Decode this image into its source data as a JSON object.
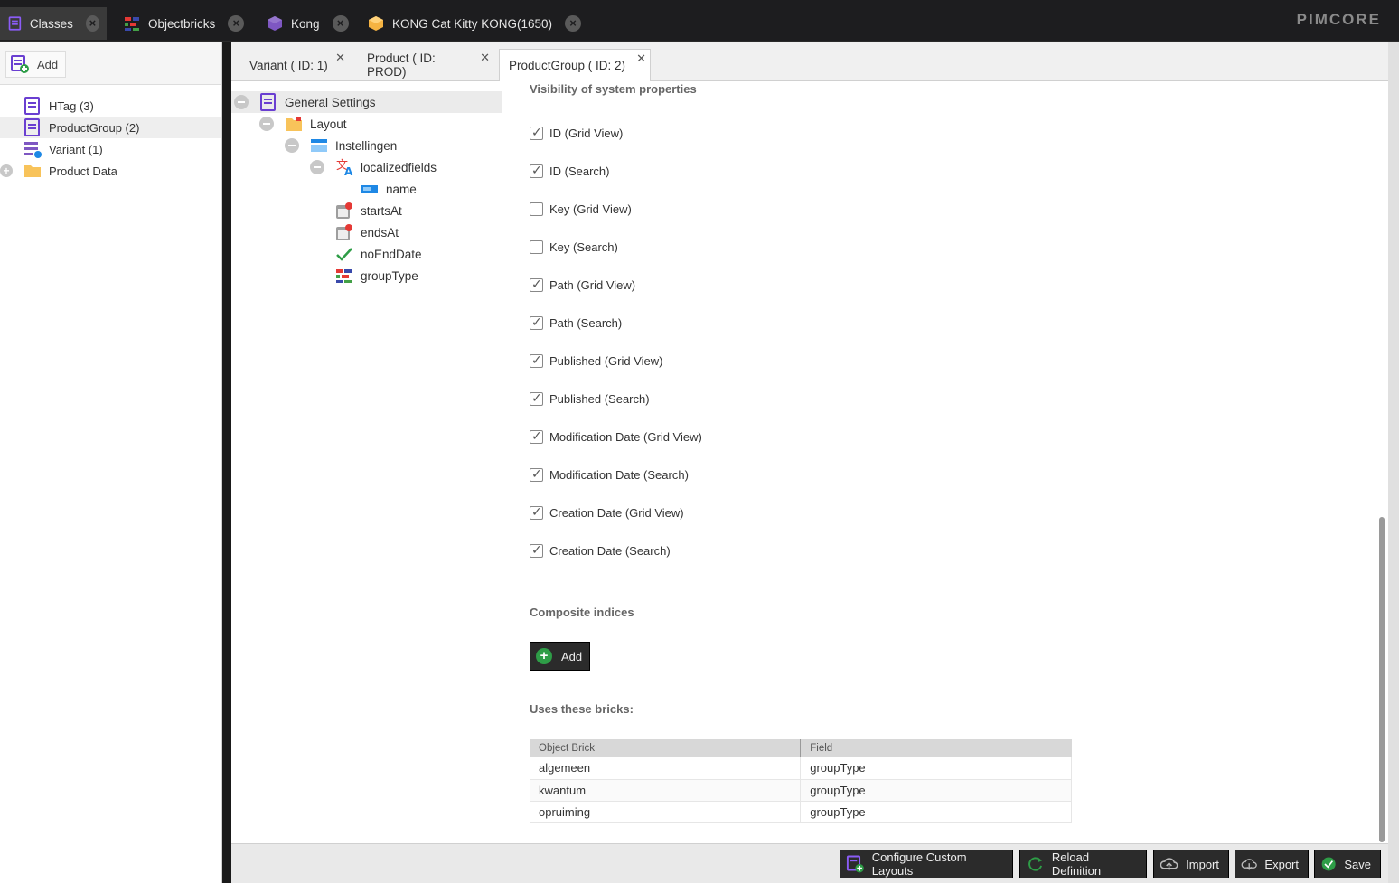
{
  "topbar": {
    "tabs": [
      {
        "label": "Classes",
        "icon": "classes-icon"
      },
      {
        "label": "Objectbricks",
        "icon": "objectbricks-icon"
      },
      {
        "label": "Kong",
        "icon": "cube-icon"
      },
      {
        "label": "KONG Cat Kitty KONG(1650)",
        "icon": "package-icon"
      }
    ],
    "logo": "PIMCORE"
  },
  "sidebar": {
    "add_label": "Add",
    "items": [
      {
        "label": "HTag (3)"
      },
      {
        "label": "ProductGroup (2)"
      },
      {
        "label": "Variant (1)"
      },
      {
        "label": "Product Data"
      }
    ]
  },
  "content_tabs": [
    {
      "label": "Variant ( ID: 1)"
    },
    {
      "label": "Product ( ID: PROD)"
    },
    {
      "label": "ProductGroup ( ID: 2)"
    }
  ],
  "layout_tree": [
    {
      "label": "General Settings"
    },
    {
      "label": "Layout"
    },
    {
      "label": "Instellingen"
    },
    {
      "label": "localizedfields"
    },
    {
      "label": "name"
    },
    {
      "label": "startsAt"
    },
    {
      "label": "endsAt"
    },
    {
      "label": "noEndDate"
    },
    {
      "label": "groupType"
    }
  ],
  "settings": {
    "visibility_title": "Visibility of system properties",
    "checkboxes": [
      {
        "label": "ID (Grid View)",
        "checked": true
      },
      {
        "label": "ID (Search)",
        "checked": true
      },
      {
        "label": "Key (Grid View)",
        "checked": false
      },
      {
        "label": "Key (Search)",
        "checked": false
      },
      {
        "label": "Path (Grid View)",
        "checked": true
      },
      {
        "label": "Path (Search)",
        "checked": true
      },
      {
        "label": "Published (Grid View)",
        "checked": true
      },
      {
        "label": "Published (Search)",
        "checked": true
      },
      {
        "label": "Modification Date (Grid View)",
        "checked": true
      },
      {
        "label": "Modification Date (Search)",
        "checked": true
      },
      {
        "label": "Creation Date (Grid View)",
        "checked": true
      },
      {
        "label": "Creation Date (Search)",
        "checked": true
      }
    ],
    "composite_title": "Composite indices",
    "composite_add_label": "Add",
    "bricks_title": "Uses these bricks:",
    "bricks_columns": [
      "Object Brick",
      "Field"
    ],
    "bricks_rows": [
      [
        "algemeen",
        "groupType"
      ],
      [
        "kwantum",
        "groupType"
      ],
      [
        "opruiming",
        "groupType"
      ]
    ]
  },
  "footer": {
    "configure_label": "Configure Custom Layouts",
    "reload_label": "Reload Definition",
    "import_label": "Import",
    "export_label": "Export",
    "save_label": "Save"
  },
  "colors": {
    "accent_purple": "#6a3fd1",
    "save_green": "#2e9d47",
    "dark_button": "#2b2b2b"
  }
}
